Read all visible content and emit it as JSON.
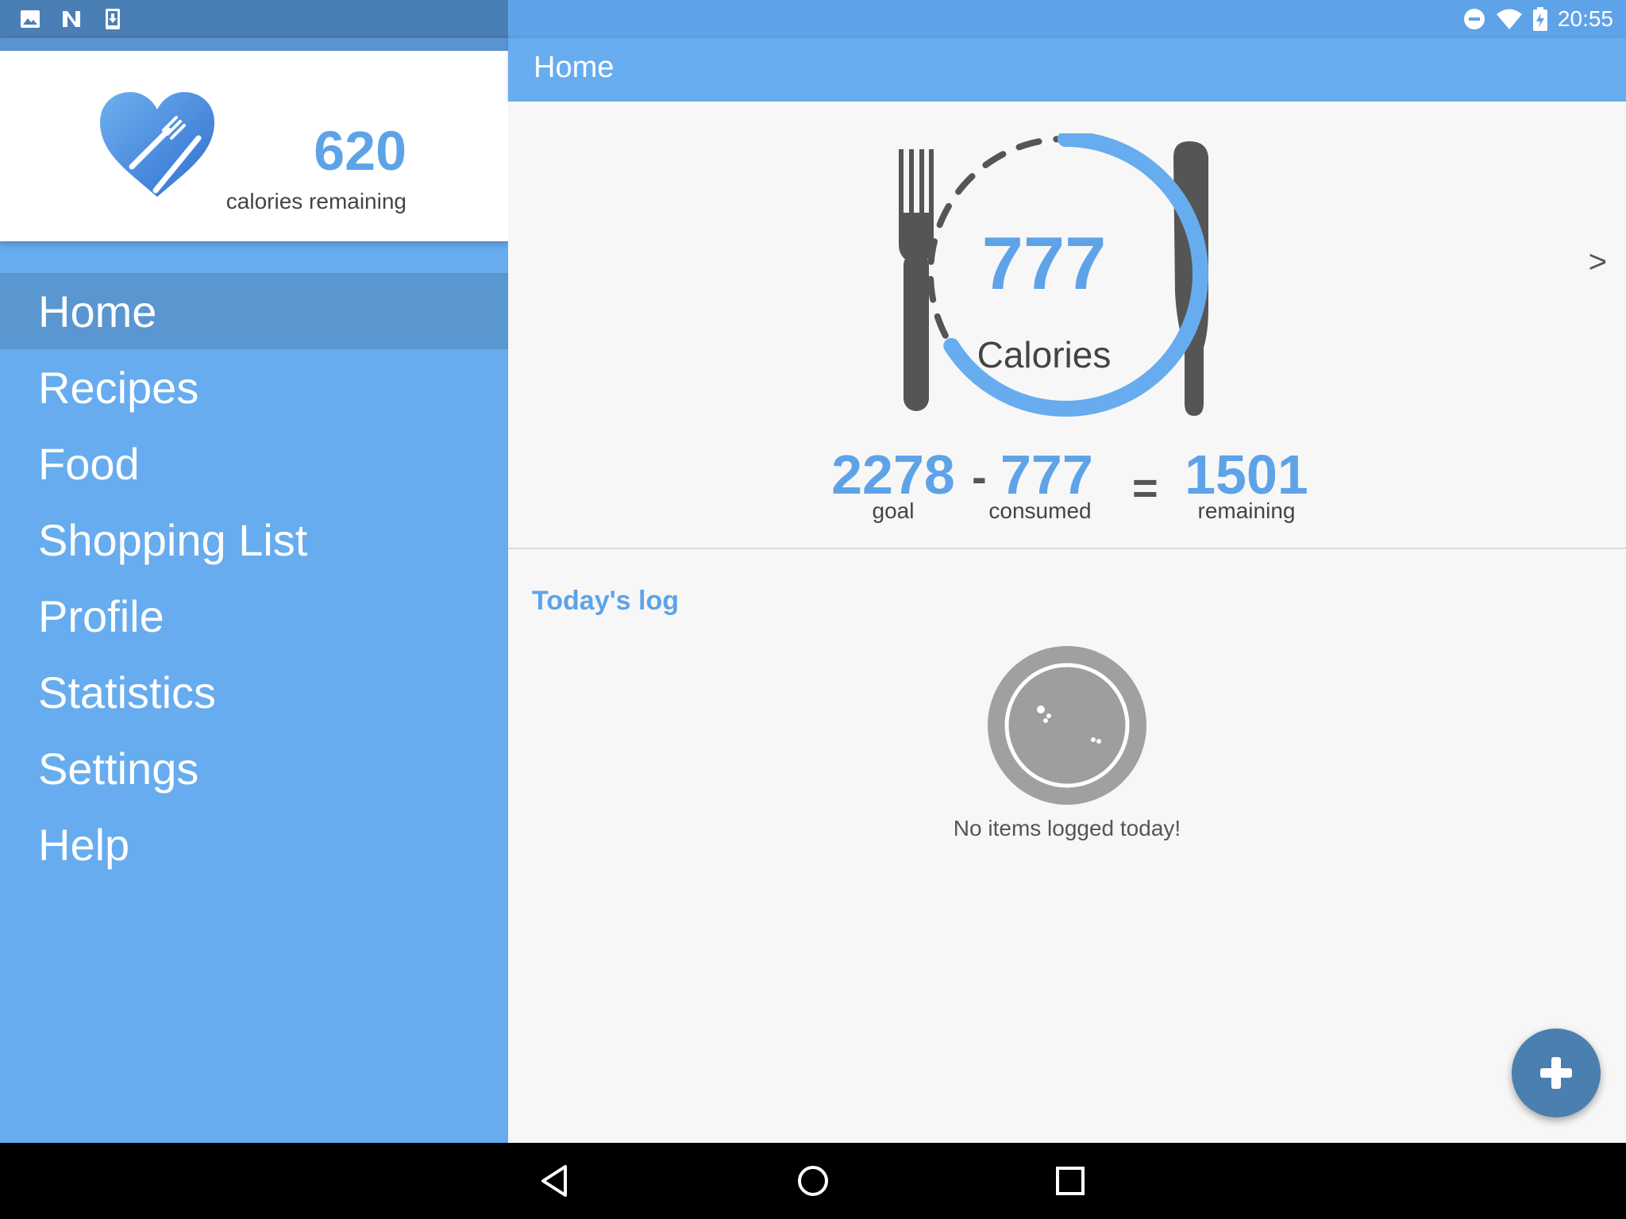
{
  "status_bar": {
    "time": "20:55",
    "left_icons": [
      "image-icon",
      "n-icon",
      "download-icon"
    ],
    "right_icons": [
      "do-not-disturb-icon",
      "wifi-icon",
      "battery-charging-icon"
    ]
  },
  "drawer": {
    "calories_remaining_value": "620",
    "calories_remaining_label": "calories remaining",
    "items": [
      {
        "label": "Home",
        "active": true
      },
      {
        "label": "Recipes"
      },
      {
        "label": "Food"
      },
      {
        "label": "Shopping List"
      },
      {
        "label": "Profile"
      },
      {
        "label": "Statistics"
      },
      {
        "label": "Settings"
      },
      {
        "label": "Help"
      }
    ]
  },
  "app_bar": {
    "title": "Home"
  },
  "summary": {
    "consumed_value": "777",
    "consumed_unit": "Calories",
    "next_arrow": ">",
    "goal": "2278",
    "goal_label": "goal",
    "minus": "-",
    "consumed": "777",
    "consumed_label": "consumed",
    "equals": "=",
    "remaining": "1501",
    "remaining_label": "remaining",
    "progress_fraction": 0.34
  },
  "log": {
    "title": "Today's log",
    "empty_text": "No items logged today!"
  },
  "colors": {
    "primary": "#67acee",
    "accent": "#5ea3e8",
    "fab": "#4a7fb0"
  }
}
